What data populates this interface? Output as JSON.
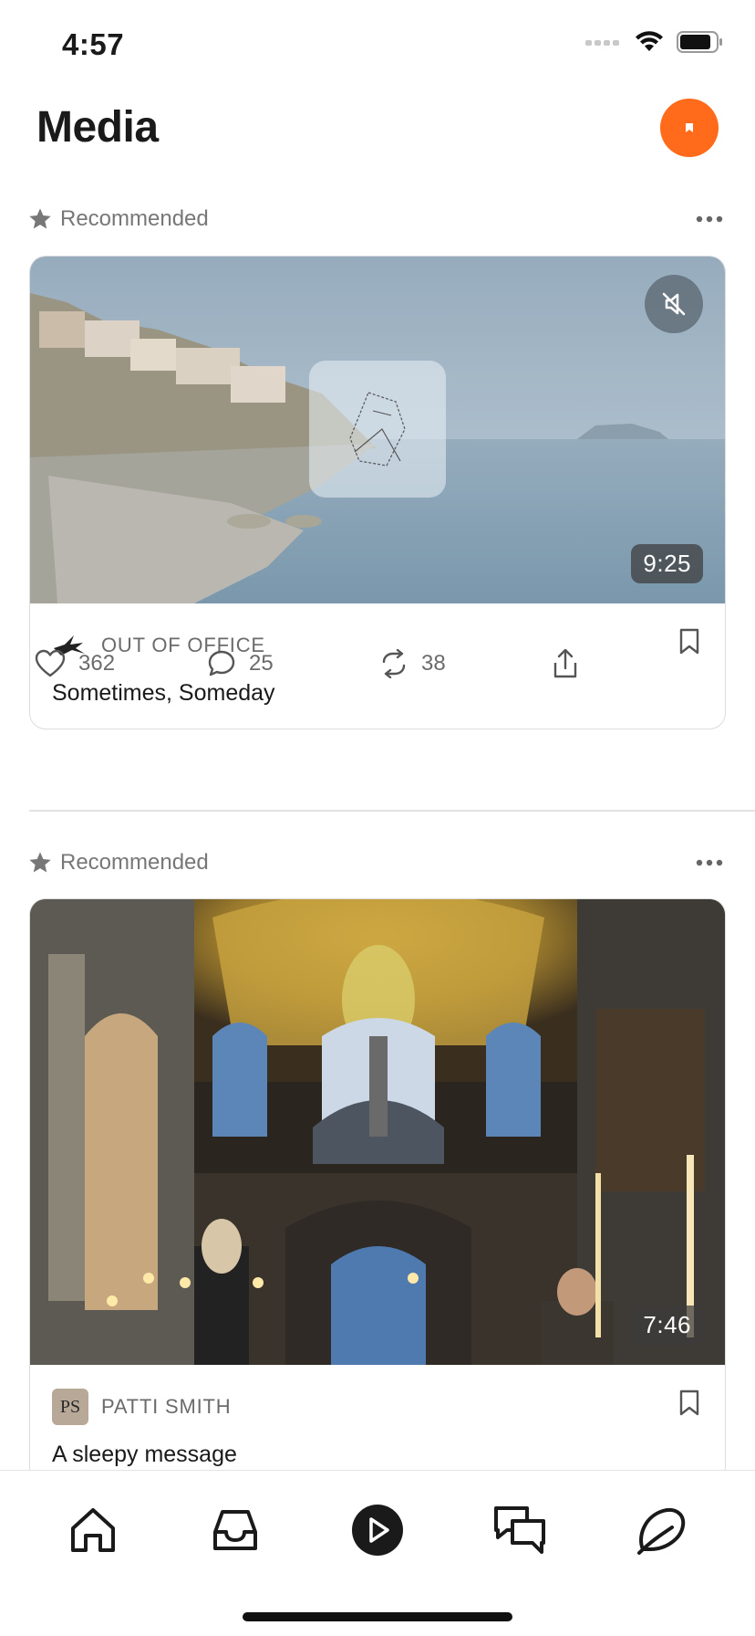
{
  "status_bar": {
    "time": "4:57"
  },
  "header": {
    "title": "Media",
    "accent": "#ff6b1a"
  },
  "posts": [
    {
      "label": "Recommended",
      "duration": "9:25",
      "publication": "OUT OF OFFICE",
      "title": "Sometimes, Someday",
      "likes": "362",
      "comments": "25",
      "restacks": "38"
    },
    {
      "label": "Recommended",
      "duration": "7:46",
      "publication": "PATTI SMITH",
      "publication_initials": "PS",
      "title": "A sleepy message"
    }
  ],
  "tabbar": {
    "items": [
      "home-icon",
      "inbox-icon",
      "play-icon",
      "chat-icon",
      "explore-icon"
    ],
    "active": "play-icon"
  }
}
